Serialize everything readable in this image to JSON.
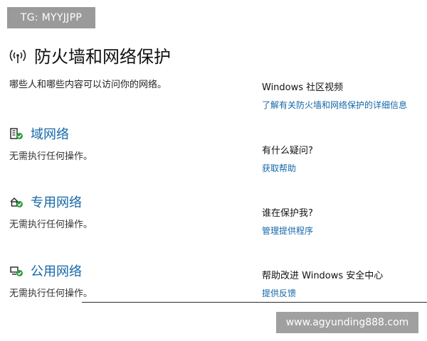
{
  "watermarks": {
    "top": "TG: MYYJJPP",
    "bottom": "www.agyunding888.com"
  },
  "header": {
    "title": "防火墙和网络保护",
    "icon": "wifi-signal-icon"
  },
  "subtitle": "哪些人和哪些内容可以访问你的网络。",
  "networks": [
    {
      "title": "域网络",
      "status": "无需执行任何操作。",
      "icon": "domain-building-icon"
    },
    {
      "title": "专用网络",
      "status": "无需执行任何操作。",
      "icon": "private-home-icon"
    },
    {
      "title": "公用网络",
      "status": "无需执行任何操作。",
      "icon": "public-monitor-icon"
    }
  ],
  "side_panel": [
    {
      "heading": "Windows 社区视频",
      "link": "了解有关防火墙和网络保护的详细信息"
    },
    {
      "heading": "有什么疑问?",
      "link": "获取帮助"
    },
    {
      "heading": "谁在保护我?",
      "link": "管理提供程序"
    },
    {
      "heading": "帮助改进 Windows 安全中心",
      "link": "提供反馈"
    }
  ],
  "colors": {
    "link": "#1467a8",
    "check": "#2e9a3a"
  }
}
